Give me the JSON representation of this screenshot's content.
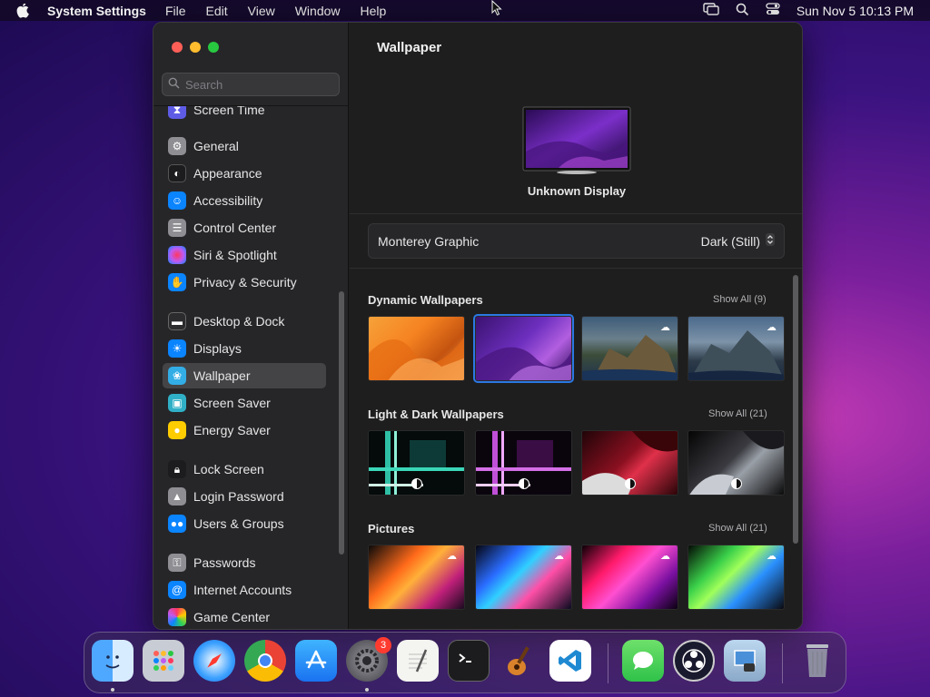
{
  "menubar": {
    "app_name": "System Settings",
    "menus": [
      "File",
      "Edit",
      "View",
      "Window",
      "Help"
    ],
    "clock": "Sun Nov 5  10:13 PM"
  },
  "sidebar": {
    "search_placeholder": "Search",
    "items": [
      {
        "label": "Screen Time",
        "icon": "hourglass-icon",
        "color": "#5e5ce6"
      },
      {
        "label": "General",
        "icon": "gear-icon",
        "color": "#8e8e93"
      },
      {
        "label": "Appearance",
        "icon": "appearance-icon",
        "color": "#1c1c1e"
      },
      {
        "label": "Accessibility",
        "icon": "accessibility-icon",
        "color": "#0a84ff"
      },
      {
        "label": "Control Center",
        "icon": "control-center-icon",
        "color": "#8e8e93"
      },
      {
        "label": "Siri & Spotlight",
        "icon": "siri-icon",
        "color": "#bf5af2"
      },
      {
        "label": "Privacy & Security",
        "icon": "hand-icon",
        "color": "#0a84ff"
      },
      {
        "label": "Desktop & Dock",
        "icon": "desktop-icon",
        "color": "#2c2c2e"
      },
      {
        "label": "Displays",
        "icon": "sun-icon",
        "color": "#0a84ff"
      },
      {
        "label": "Wallpaper",
        "icon": "flower-icon",
        "color": "#32ade6"
      },
      {
        "label": "Screen Saver",
        "icon": "screen-saver-icon",
        "color": "#30b0c7"
      },
      {
        "label": "Energy Saver",
        "icon": "bulb-icon",
        "color": "#ffcc00"
      },
      {
        "label": "Lock Screen",
        "icon": "lock-icon",
        "color": "#1c1c1e"
      },
      {
        "label": "Login Password",
        "icon": "padlock-icon",
        "color": "#8e8e93"
      },
      {
        "label": "Users & Groups",
        "icon": "users-icon",
        "color": "#0a84ff"
      },
      {
        "label": "Passwords",
        "icon": "key-icon",
        "color": "#8e8e93"
      },
      {
        "label": "Internet Accounts",
        "icon": "at-icon",
        "color": "#0a84ff"
      },
      {
        "label": "Game Center",
        "icon": "game-center-icon",
        "color": "#ffffff"
      }
    ]
  },
  "main": {
    "title": "Wallpaper",
    "display_name": "Unknown Display",
    "wallpaper_name": "Monterey Graphic",
    "appearance_value": "Dark (Still)",
    "sections": [
      {
        "title": "Dynamic Wallpapers",
        "show_all": "Show All (9)"
      },
      {
        "title": "Light & Dark Wallpapers",
        "show_all": "Show All (21)"
      },
      {
        "title": "Pictures",
        "show_all": "Show All (21)"
      }
    ]
  },
  "dock": {
    "apps": [
      "Finder",
      "Launchpad",
      "Safari",
      "Chrome",
      "App Store",
      "System Settings",
      "TextEdit",
      "Terminal",
      "GarageBand",
      "VS Code",
      "Messages",
      "OBS",
      "Preview",
      "Trash"
    ],
    "settings_badge": "3"
  }
}
